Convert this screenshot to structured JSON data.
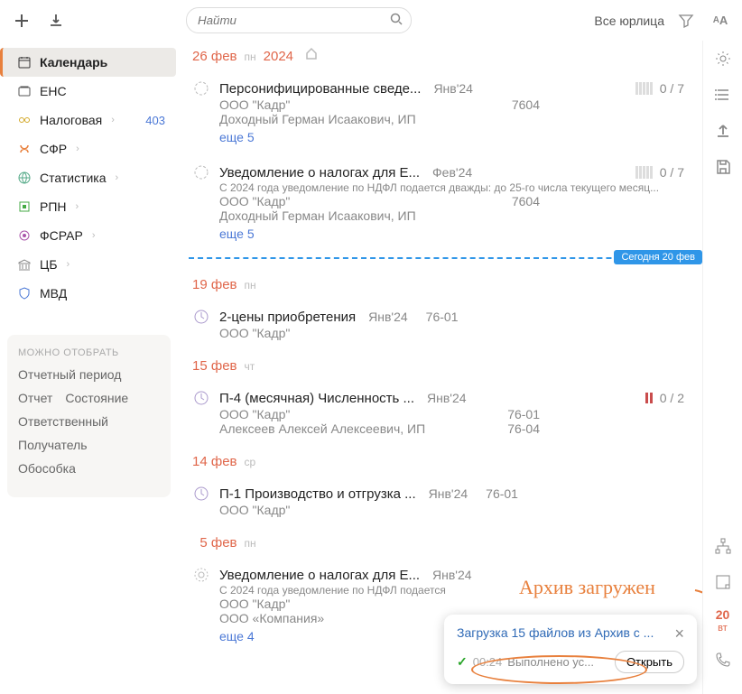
{
  "top": {
    "search_placeholder": "Найти",
    "legal_label": "Все юрлица"
  },
  "sidebar": {
    "items": [
      {
        "label": "Календарь"
      },
      {
        "label": "ЕНС"
      },
      {
        "label": "Налоговая",
        "badge": "403"
      },
      {
        "label": "СФР"
      },
      {
        "label": "Статистика"
      },
      {
        "label": "РПН"
      },
      {
        "label": "ФСРАР"
      },
      {
        "label": "ЦБ"
      },
      {
        "label": "МВД"
      }
    ],
    "filter": {
      "title": "МОЖНО ОТОБРАТЬ",
      "rows": [
        [
          "Отчетный период"
        ],
        [
          "Отчет",
          "Состояние"
        ],
        [
          "Ответственный"
        ],
        [
          "Получатель"
        ],
        [
          "Обособка"
        ]
      ]
    }
  },
  "header_date": {
    "day": "26",
    "mon": "фев",
    "dow": "пн",
    "year": "2024"
  },
  "reports": [
    {
      "title": "Персонифицированные сведе...",
      "period": "Янв'24",
      "count": "0 / 7",
      "subs": [
        {
          "name": "ООО \"Кадр\"",
          "code": "7604"
        },
        {
          "name": "Доходный Герман Исаакович, ИП"
        }
      ],
      "more": "еще 5",
      "stripes": true
    },
    {
      "title": "Уведомление о налогах для Е...",
      "period": "Фев'24",
      "count": "0 / 7",
      "note": "С 2024 года уведомление по НДФЛ подается дважды: до 25-го числа текущего месяц...",
      "subs": [
        {
          "name": "ООО \"Кадр\"",
          "code": "7604"
        },
        {
          "name": "Доходный Герман Исаакович, ИП"
        }
      ],
      "more": "еще 5",
      "stripes": true
    }
  ],
  "today_label": "Сегодня 20 фев",
  "groups": [
    {
      "day": "19",
      "mon": "фев",
      "dow": "пн",
      "reports": [
        {
          "title": "2-цены приобретения",
          "period": "Янв'24",
          "code_r": "76-01",
          "subs": [
            {
              "name": "ООО \"Кадр\""
            }
          ]
        }
      ]
    },
    {
      "day": "15",
      "mon": "фев",
      "dow": "чт",
      "reports": [
        {
          "title": "П-4 (месячная) Численность ...",
          "period": "Янв'24",
          "count": "0 / 2",
          "pause": true,
          "subs": [
            {
              "name": "ООО \"Кадр\"",
              "code": "76-01"
            },
            {
              "name": "Алексеев Алексей Алексеевич, ИП",
              "code": "76-04"
            }
          ]
        }
      ]
    },
    {
      "day": "14",
      "mon": "фев",
      "dow": "ср",
      "reports": [
        {
          "title": "П-1 Производство и отгрузка ...",
          "period": "Янв'24",
          "code_r": "76-01",
          "subs": [
            {
              "name": "ООО \"Кадр\""
            }
          ]
        }
      ]
    },
    {
      "day": "5",
      "mon": "фев",
      "dow": "пн",
      "reports": [
        {
          "title": "Уведомление о налогах для Е...",
          "period": "Янв'24",
          "note": "С 2024 года уведомление по НДФЛ подается",
          "subs": [
            {
              "name": "ООО \"Кадр\""
            },
            {
              "name": "ООО «Компания»"
            }
          ],
          "more": "еще 4"
        }
      ]
    }
  ],
  "mini_date": {
    "day": "20",
    "dow": "вт"
  },
  "annotation": "Архив загружен",
  "notif": {
    "title": "Загрузка 15 файлов из Архив с ...",
    "time": "00:24",
    "status": "Выполнено ус...",
    "open": "Открыть"
  }
}
